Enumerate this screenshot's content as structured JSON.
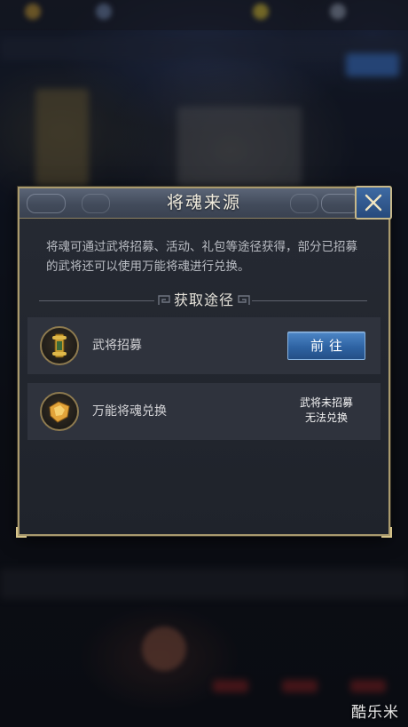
{
  "dialog": {
    "title": "将魂来源",
    "description": "将魂可通过武将招募、活动、礼包等途径获得，部分已招募的武将还可以使用万能将魂进行兑换。",
    "section_title": "获取途径",
    "routes": [
      {
        "label": "武将招募",
        "icon": "scroll-icon",
        "action_label": "前往"
      },
      {
        "label": "万能将魂兑换",
        "icon": "soul-shard-icon",
        "status_line1": "武将未招募",
        "status_line2": "无法兑换"
      }
    ]
  },
  "watermark": "酷乐米",
  "colors": {
    "frame_gold": "#a99a6e",
    "title_bar": "#4a5363",
    "button_blue": "#3a72b4",
    "panel_bg": "#22262e"
  }
}
